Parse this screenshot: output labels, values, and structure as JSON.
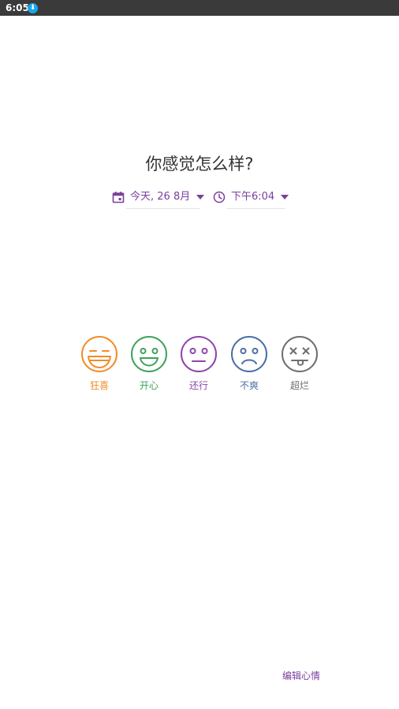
{
  "status_bar": {
    "time": "6:05",
    "notification_icon": "notification-icon"
  },
  "title": "你感觉怎么样?",
  "date_picker": {
    "icon": "calendar-icon",
    "text": "今天, 26 8月"
  },
  "time_picker": {
    "icon": "clock-icon",
    "text": "下午6:04"
  },
  "moods": [
    {
      "name": "狂喜",
      "icon": "rad-face-icon",
      "color": "#f28c28"
    },
    {
      "name": "开心",
      "icon": "good-face-icon",
      "color": "#3fa15b"
    },
    {
      "name": "还行",
      "icon": "meh-face-icon",
      "color": "#8e44ad"
    },
    {
      "name": "不爽",
      "icon": "bad-face-icon",
      "color": "#4a6fa5"
    },
    {
      "name": "超烂",
      "icon": "awful-face-icon",
      "color": "#6e6e6e"
    }
  ],
  "edit_link": "编辑心情",
  "accent_color": "#7a3f9c"
}
